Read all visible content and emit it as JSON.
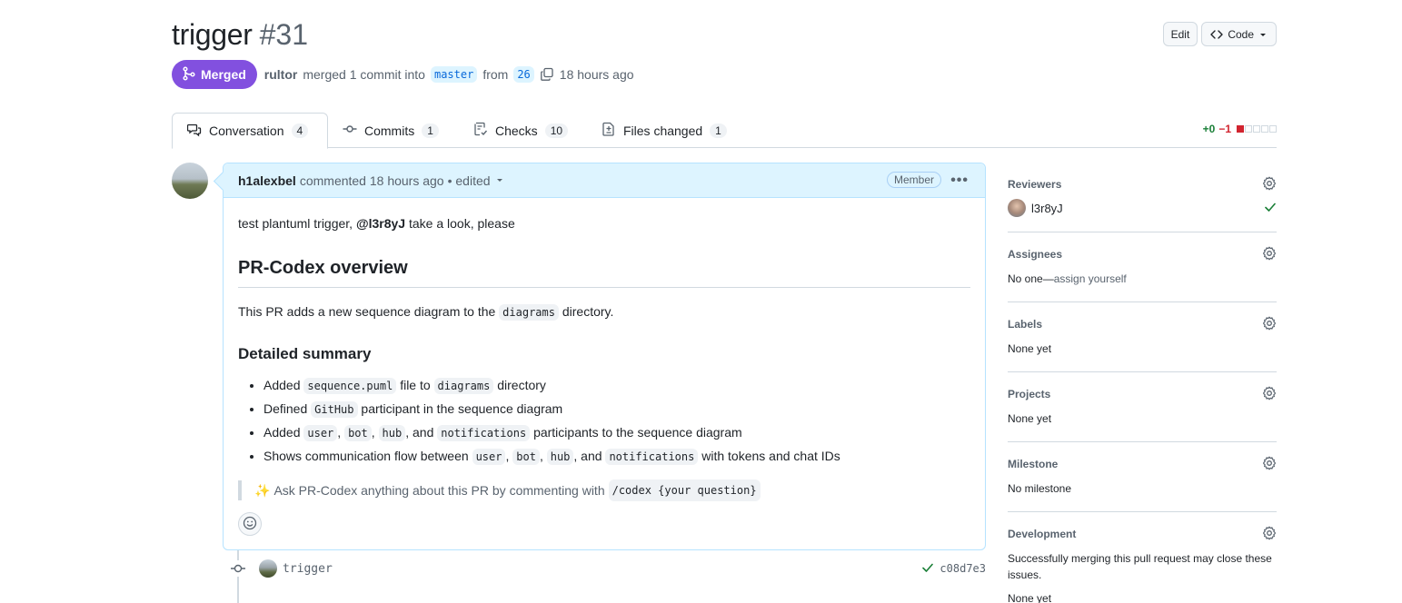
{
  "pr": {
    "title": "trigger",
    "number": "#31",
    "state": "Merged",
    "author": "rultor",
    "merge_text": "merged 1 commit into",
    "base_branch": "master",
    "from_text": "from",
    "head_branch": "26",
    "time": "18 hours ago"
  },
  "header_actions": {
    "edit": "Edit",
    "code": "Code"
  },
  "tabs": [
    {
      "label": "Conversation",
      "count": "4"
    },
    {
      "label": "Commits",
      "count": "1"
    },
    {
      "label": "Checks",
      "count": "10"
    },
    {
      "label": "Files changed",
      "count": "1"
    }
  ],
  "diffstat": {
    "additions": "+0",
    "deletions": "−1"
  },
  "comment": {
    "author": "h1alexbel",
    "action": "commented 18 hours ago",
    "edited": "• edited",
    "role": "Member",
    "intro_text": "test plantuml trigger,",
    "mention": "@l3r8yJ",
    "intro_tail": "take a look, please",
    "heading": "PR-Codex overview",
    "overview_pre": "This PR adds a new sequence diagram to the",
    "overview_code": "diagrams",
    "overview_post": "directory.",
    "summary_heading": "Detailed summary",
    "summary": {
      "item1": {
        "pre": "Added",
        "code1": "sequence.puml",
        "mid": "file to",
        "code2": "diagrams",
        "post": "directory"
      },
      "item2": {
        "pre": "Defined",
        "code1": "GitHub",
        "post": "participant in the sequence diagram"
      },
      "item3": {
        "pre": "Added",
        "c1": "user",
        "c2": "bot",
        "c3": "hub",
        "and": ", and",
        "c4": "notifications",
        "post": "participants to the sequence diagram"
      },
      "item4": {
        "pre": "Shows communication flow between",
        "c1": "user",
        "c2": "bot",
        "c3": "hub",
        "and": ", and",
        "c4": "notifications",
        "post": "with tokens and chat IDs"
      }
    },
    "quote_emoji": "✨",
    "quote_text": "Ask PR-Codex anything about this PR by commenting with",
    "quote_code": "/codex {your question}"
  },
  "commit": {
    "message": "trigger",
    "sha": "c08d7e3"
  },
  "sidebar": {
    "reviewers": {
      "title": "Reviewers",
      "name": "l3r8yJ"
    },
    "assignees": {
      "title": "Assignees",
      "value_pre": "No one—",
      "value_link": "assign yourself"
    },
    "labels": {
      "title": "Labels",
      "value": "None yet"
    },
    "projects": {
      "title": "Projects",
      "value": "None yet"
    },
    "milestone": {
      "title": "Milestone",
      "value": "No milestone"
    },
    "development": {
      "title": "Development",
      "value": "Successfully merging this pull request may close these issues.",
      "value2": "None yet"
    }
  },
  "colors": {
    "merged": "#8250df",
    "link": "#0969da",
    "success": "#1a7f37",
    "danger": "#d1242f",
    "comment_header": "#ddf4ff"
  }
}
